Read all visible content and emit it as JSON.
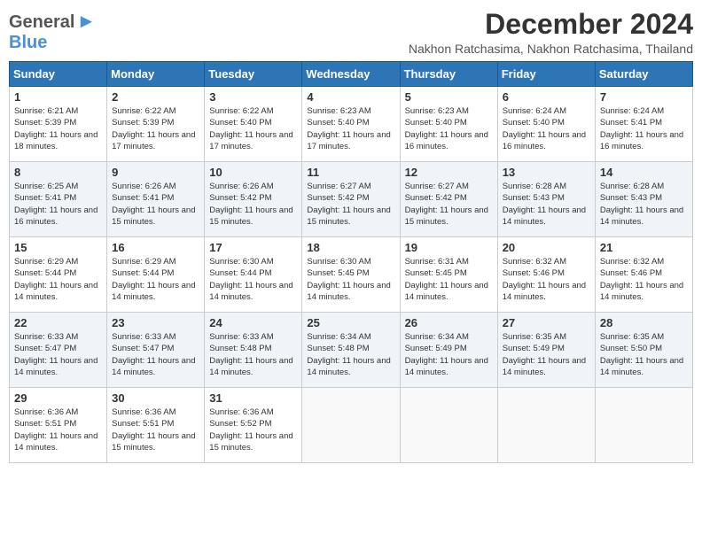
{
  "logo": {
    "general": "General",
    "blue": "Blue"
  },
  "title": "December 2024",
  "location": "Nakhon Ratchasima, Nakhon Ratchasima, Thailand",
  "days_of_week": [
    "Sunday",
    "Monday",
    "Tuesday",
    "Wednesday",
    "Thursday",
    "Friday",
    "Saturday"
  ],
  "weeks": [
    [
      {
        "day": 1,
        "sunrise": "Sunrise: 6:21 AM",
        "sunset": "Sunset: 5:39 PM",
        "daylight": "Daylight: 11 hours and 18 minutes."
      },
      {
        "day": 2,
        "sunrise": "Sunrise: 6:22 AM",
        "sunset": "Sunset: 5:39 PM",
        "daylight": "Daylight: 11 hours and 17 minutes."
      },
      {
        "day": 3,
        "sunrise": "Sunrise: 6:22 AM",
        "sunset": "Sunset: 5:40 PM",
        "daylight": "Daylight: 11 hours and 17 minutes."
      },
      {
        "day": 4,
        "sunrise": "Sunrise: 6:23 AM",
        "sunset": "Sunset: 5:40 PM",
        "daylight": "Daylight: 11 hours and 17 minutes."
      },
      {
        "day": 5,
        "sunrise": "Sunrise: 6:23 AM",
        "sunset": "Sunset: 5:40 PM",
        "daylight": "Daylight: 11 hours and 16 minutes."
      },
      {
        "day": 6,
        "sunrise": "Sunrise: 6:24 AM",
        "sunset": "Sunset: 5:40 PM",
        "daylight": "Daylight: 11 hours and 16 minutes."
      },
      {
        "day": 7,
        "sunrise": "Sunrise: 6:24 AM",
        "sunset": "Sunset: 5:41 PM",
        "daylight": "Daylight: 11 hours and 16 minutes."
      }
    ],
    [
      {
        "day": 8,
        "sunrise": "Sunrise: 6:25 AM",
        "sunset": "Sunset: 5:41 PM",
        "daylight": "Daylight: 11 hours and 16 minutes."
      },
      {
        "day": 9,
        "sunrise": "Sunrise: 6:26 AM",
        "sunset": "Sunset: 5:41 PM",
        "daylight": "Daylight: 11 hours and 15 minutes."
      },
      {
        "day": 10,
        "sunrise": "Sunrise: 6:26 AM",
        "sunset": "Sunset: 5:42 PM",
        "daylight": "Daylight: 11 hours and 15 minutes."
      },
      {
        "day": 11,
        "sunrise": "Sunrise: 6:27 AM",
        "sunset": "Sunset: 5:42 PM",
        "daylight": "Daylight: 11 hours and 15 minutes."
      },
      {
        "day": 12,
        "sunrise": "Sunrise: 6:27 AM",
        "sunset": "Sunset: 5:42 PM",
        "daylight": "Daylight: 11 hours and 15 minutes."
      },
      {
        "day": 13,
        "sunrise": "Sunrise: 6:28 AM",
        "sunset": "Sunset: 5:43 PM",
        "daylight": "Daylight: 11 hours and 14 minutes."
      },
      {
        "day": 14,
        "sunrise": "Sunrise: 6:28 AM",
        "sunset": "Sunset: 5:43 PM",
        "daylight": "Daylight: 11 hours and 14 minutes."
      }
    ],
    [
      {
        "day": 15,
        "sunrise": "Sunrise: 6:29 AM",
        "sunset": "Sunset: 5:44 PM",
        "daylight": "Daylight: 11 hours and 14 minutes."
      },
      {
        "day": 16,
        "sunrise": "Sunrise: 6:29 AM",
        "sunset": "Sunset: 5:44 PM",
        "daylight": "Daylight: 11 hours and 14 minutes."
      },
      {
        "day": 17,
        "sunrise": "Sunrise: 6:30 AM",
        "sunset": "Sunset: 5:44 PM",
        "daylight": "Daylight: 11 hours and 14 minutes."
      },
      {
        "day": 18,
        "sunrise": "Sunrise: 6:30 AM",
        "sunset": "Sunset: 5:45 PM",
        "daylight": "Daylight: 11 hours and 14 minutes."
      },
      {
        "day": 19,
        "sunrise": "Sunrise: 6:31 AM",
        "sunset": "Sunset: 5:45 PM",
        "daylight": "Daylight: 11 hours and 14 minutes."
      },
      {
        "day": 20,
        "sunrise": "Sunrise: 6:32 AM",
        "sunset": "Sunset: 5:46 PM",
        "daylight": "Daylight: 11 hours and 14 minutes."
      },
      {
        "day": 21,
        "sunrise": "Sunrise: 6:32 AM",
        "sunset": "Sunset: 5:46 PM",
        "daylight": "Daylight: 11 hours and 14 minutes."
      }
    ],
    [
      {
        "day": 22,
        "sunrise": "Sunrise: 6:33 AM",
        "sunset": "Sunset: 5:47 PM",
        "daylight": "Daylight: 11 hours and 14 minutes."
      },
      {
        "day": 23,
        "sunrise": "Sunrise: 6:33 AM",
        "sunset": "Sunset: 5:47 PM",
        "daylight": "Daylight: 11 hours and 14 minutes."
      },
      {
        "day": 24,
        "sunrise": "Sunrise: 6:33 AM",
        "sunset": "Sunset: 5:48 PM",
        "daylight": "Daylight: 11 hours and 14 minutes."
      },
      {
        "day": 25,
        "sunrise": "Sunrise: 6:34 AM",
        "sunset": "Sunset: 5:48 PM",
        "daylight": "Daylight: 11 hours and 14 minutes."
      },
      {
        "day": 26,
        "sunrise": "Sunrise: 6:34 AM",
        "sunset": "Sunset: 5:49 PM",
        "daylight": "Daylight: 11 hours and 14 minutes."
      },
      {
        "day": 27,
        "sunrise": "Sunrise: 6:35 AM",
        "sunset": "Sunset: 5:49 PM",
        "daylight": "Daylight: 11 hours and 14 minutes."
      },
      {
        "day": 28,
        "sunrise": "Sunrise: 6:35 AM",
        "sunset": "Sunset: 5:50 PM",
        "daylight": "Daylight: 11 hours and 14 minutes."
      }
    ],
    [
      {
        "day": 29,
        "sunrise": "Sunrise: 6:36 AM",
        "sunset": "Sunset: 5:51 PM",
        "daylight": "Daylight: 11 hours and 14 minutes."
      },
      {
        "day": 30,
        "sunrise": "Sunrise: 6:36 AM",
        "sunset": "Sunset: 5:51 PM",
        "daylight": "Daylight: 11 hours and 15 minutes."
      },
      {
        "day": 31,
        "sunrise": "Sunrise: 6:36 AM",
        "sunset": "Sunset: 5:52 PM",
        "daylight": "Daylight: 11 hours and 15 minutes."
      },
      null,
      null,
      null,
      null
    ]
  ]
}
